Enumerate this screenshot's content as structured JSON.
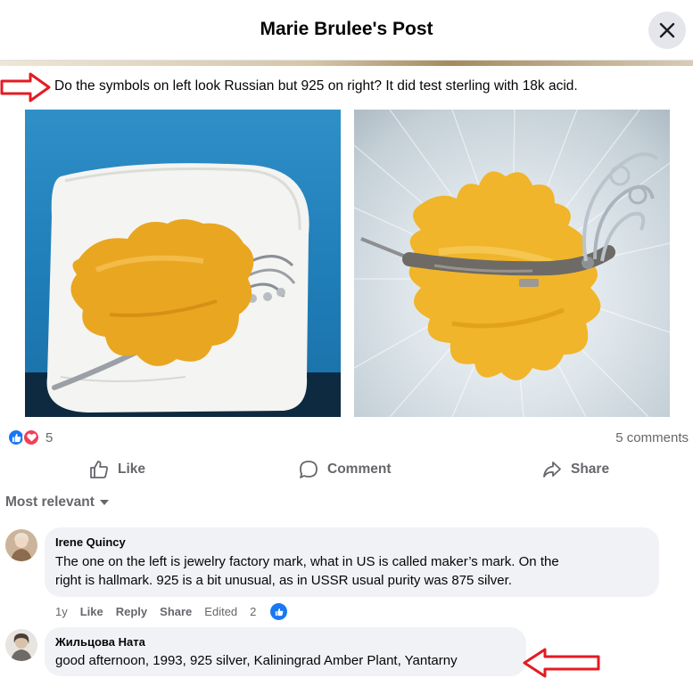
{
  "header": {
    "title": "Marie Brulee's Post"
  },
  "post": {
    "text": "Do the symbols on left look Russian but 925 on right?  It did test sterling with 18k acid."
  },
  "photos": [
    {
      "name": "amber-leaf-brooch-front"
    },
    {
      "name": "amber-leaf-brooch-back"
    }
  ],
  "reactions": {
    "count": "5",
    "comments": "5 comments"
  },
  "actions": {
    "like": "Like",
    "comment": "Comment",
    "share": "Share"
  },
  "sort": {
    "label": "Most relevant"
  },
  "comments": [
    {
      "author": "Irene Quincy",
      "text_line1": "The one on the left is jewelry factory mark, what in US is called maker’s mark. On the",
      "text_line2": "right is hallmark. 925 is a bit unusual, as in USSR usual purity was 875 silver.",
      "meta": {
        "age": "1y",
        "like": "Like",
        "reply": "Reply",
        "share": "Share",
        "edited": "Edited",
        "like_count": "2"
      }
    },
    {
      "author": "Жильцова Ната",
      "text_line1": "good afternoon, 1993, 925 silver, Kaliningrad Amber Plant, Yantarny"
    }
  ],
  "colors": {
    "accent": "#1877f2",
    "love": "#f33e58",
    "annotation_arrow": "#e31b23"
  }
}
